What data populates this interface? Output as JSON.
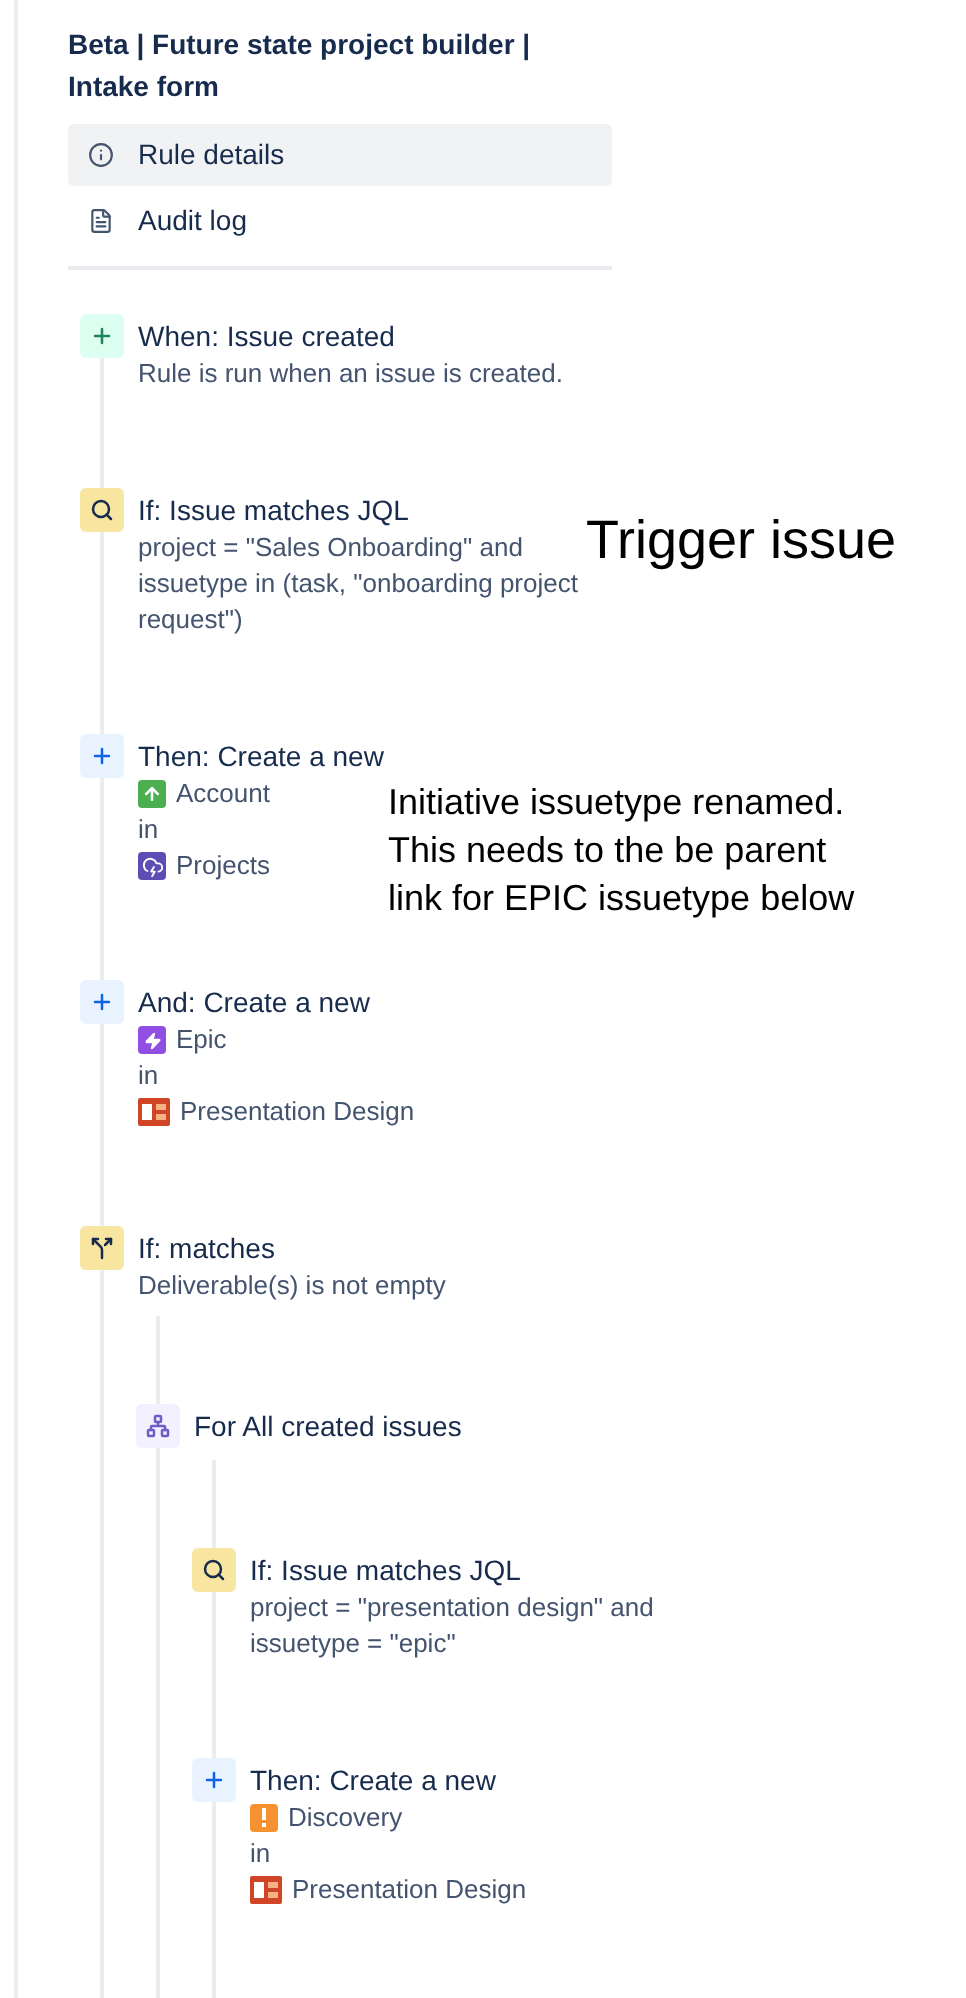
{
  "title": "Beta | Future state project builder | Intake form",
  "nav": [
    {
      "label": "Rule details",
      "kind": "info",
      "selected": true
    },
    {
      "label": "Audit log",
      "kind": "log",
      "selected": false
    }
  ],
  "steps": [
    {
      "kind": "trigger",
      "title": "When: Issue created",
      "description": "Rule is run when an issue is created."
    },
    {
      "kind": "condition",
      "title": "If: Issue matches JQL",
      "description": "project = \"Sales Onboarding\" and issuetype in (task, \"onboarding project request\")"
    },
    {
      "kind": "action",
      "title": "Then: Create a new",
      "create": {
        "issuetype": {
          "name": "Account",
          "kind": "account"
        },
        "connector": "in",
        "project": {
          "name": "Projects",
          "kind": "projects"
        }
      }
    },
    {
      "kind": "action",
      "title": "And: Create a new",
      "create": {
        "issuetype": {
          "name": "Epic",
          "kind": "epic"
        },
        "connector": "in",
        "project": {
          "name": "Presentation Design",
          "kind": "presentation"
        }
      }
    },
    {
      "kind": "branch",
      "title": "If: matches",
      "description": "Deliverable(s) is not empty",
      "children": [
        {
          "kind": "foreach",
          "title": "For All created issues",
          "children": [
            {
              "kind": "condition",
              "title": "If: Issue matches JQL",
              "description": "project = \"presentation design\" and issuetype = \"epic\""
            },
            {
              "kind": "action",
              "title": "Then: Create a new",
              "create": {
                "issuetype": {
                  "name": "Discovery",
                  "kind": "discovery"
                },
                "connector": "in",
                "project": {
                  "name": "Presentation Design",
                  "kind": "presentation"
                }
              }
            }
          ]
        }
      ]
    }
  ],
  "annotations": [
    "Trigger issue",
    "Initiative issuetype renamed. This needs to the be parent link for EPIC issuetype below"
  ]
}
